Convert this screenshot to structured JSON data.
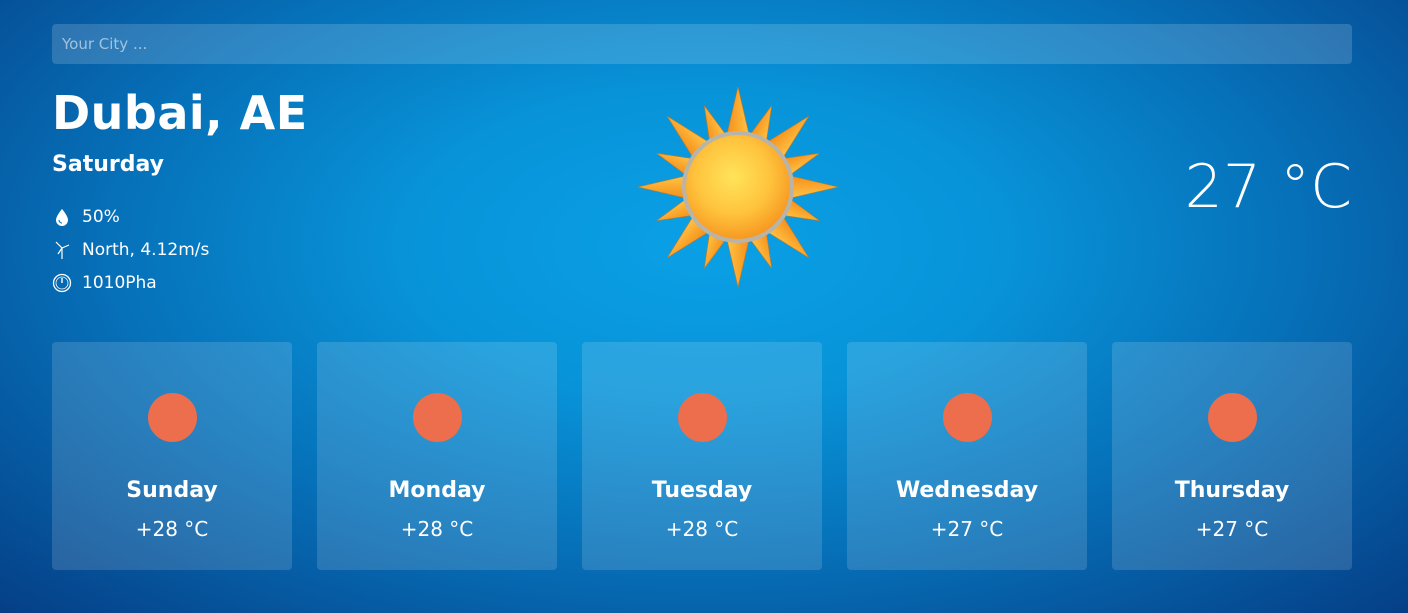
{
  "search": {
    "placeholder": "Your City ..."
  },
  "current": {
    "city": "Dubai, AE",
    "day": "Saturday",
    "humidity": "50%",
    "wind": "North, 4.12m/s",
    "pressure": "1010Pha",
    "temperature": "27 °C",
    "icon": "sun-icon"
  },
  "forecast": [
    {
      "day": "Sunday",
      "temp": "+28 °C",
      "icon": "weather-dot-icon"
    },
    {
      "day": "Monday",
      "temp": "+28 °C",
      "icon": "weather-dot-icon"
    },
    {
      "day": "Tuesday",
      "temp": "+28 °C",
      "icon": "weather-dot-icon"
    },
    {
      "day": "Wednesday",
      "temp": "+27 °C",
      "icon": "weather-dot-icon"
    },
    {
      "day": "Thursday",
      "temp": "+27 °C",
      "icon": "weather-dot-icon"
    }
  ],
  "colors": {
    "forecast_dot": "#ec6e4c",
    "sun_core": "#ffb23a"
  }
}
